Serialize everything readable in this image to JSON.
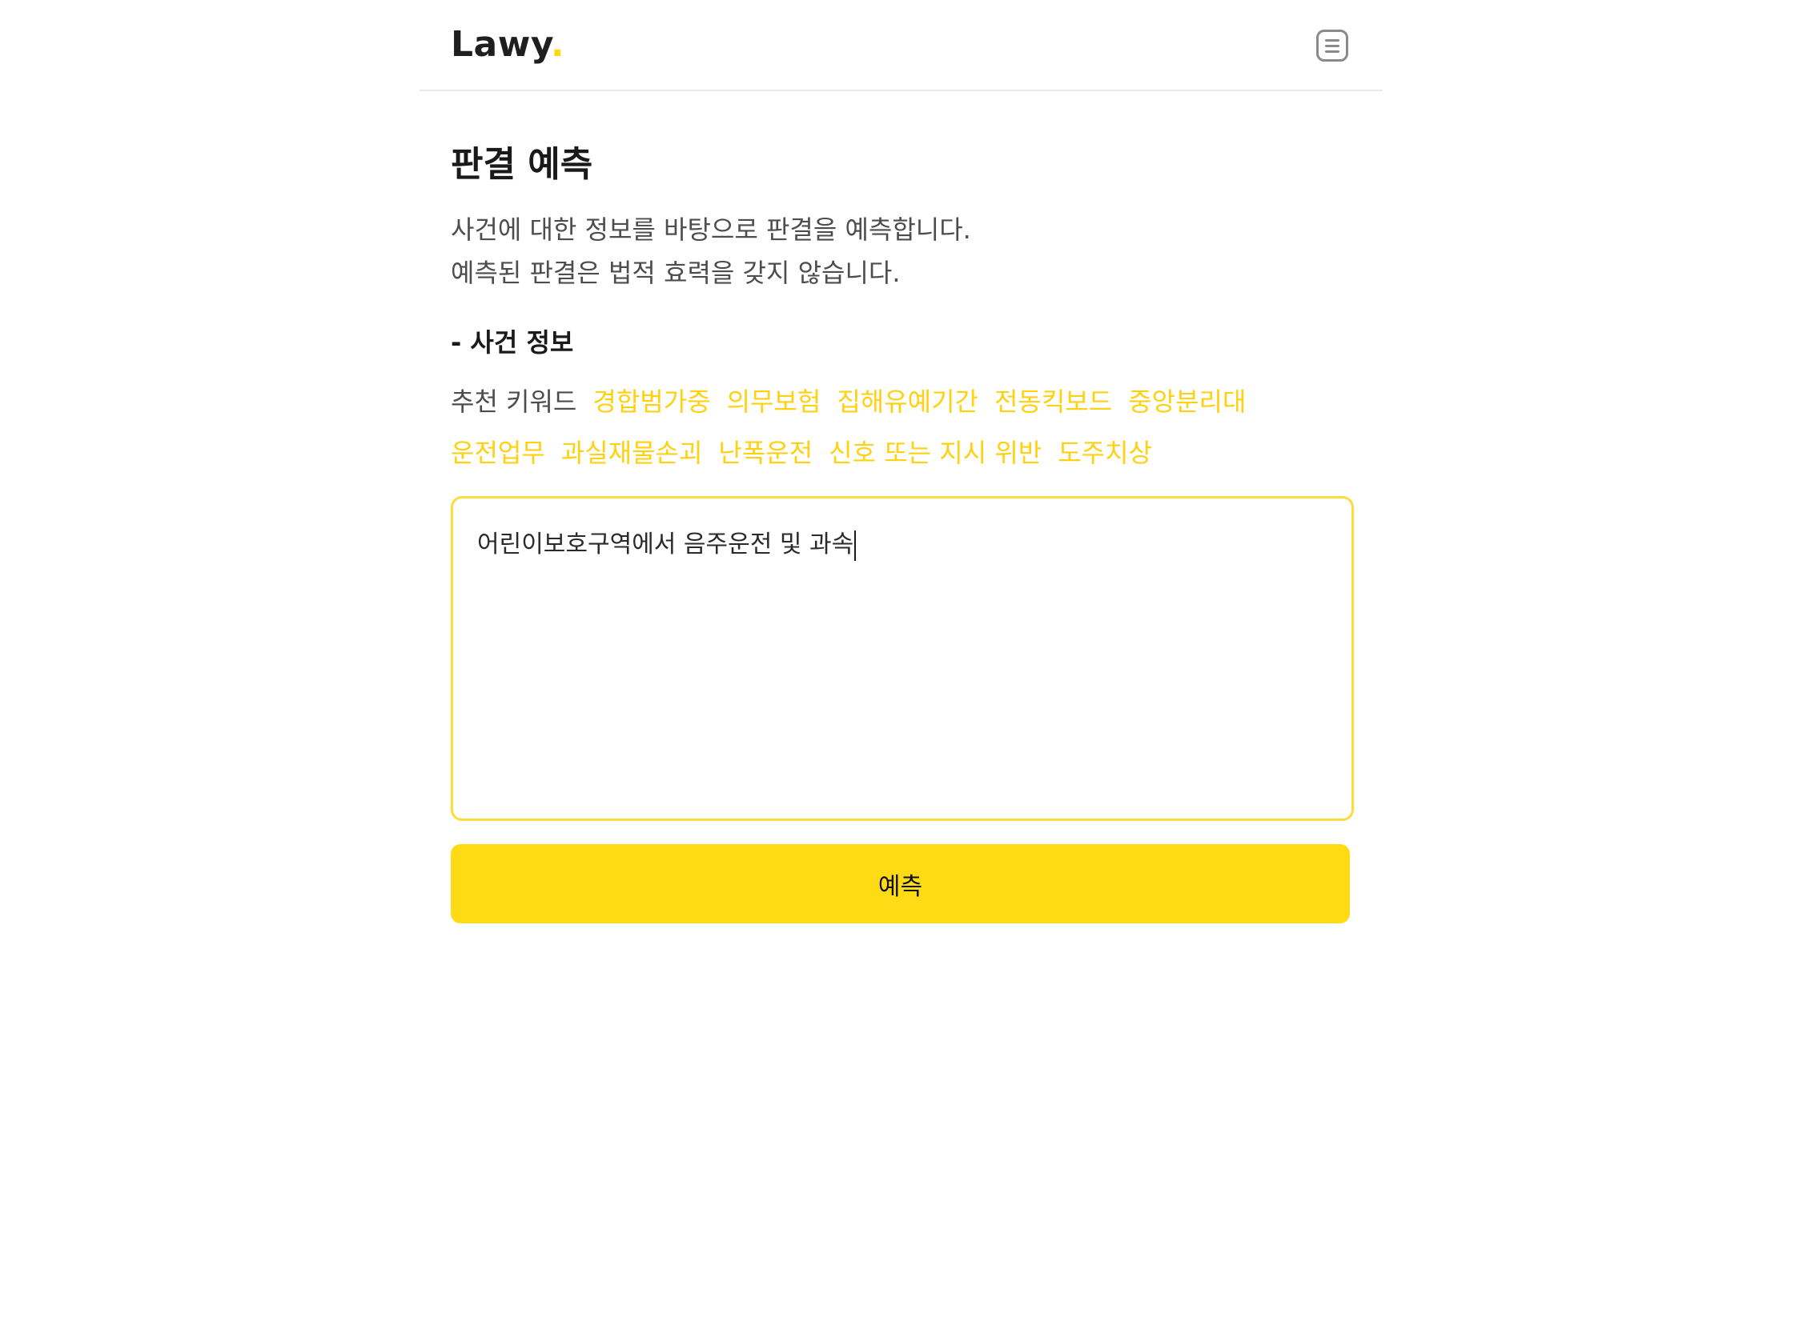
{
  "header": {
    "logo_text": "Lawy",
    "logo_dot": ".",
    "menu_icon": "hamburger-menu-icon"
  },
  "main": {
    "title": "판결 예측",
    "description_line1": "사건에 대한 정보를 바탕으로 판결을 예측합니다.",
    "description_line2": "예측된 판결은 법적 효력을 갖지 않습니다.",
    "section_title": "- 사건 정보",
    "keywords_label": "추천 키워드",
    "keywords": [
      "경합범가중",
      "의무보험",
      "집해유예기간",
      "전동킥보드",
      "중앙분리대",
      "운전업무",
      "과실재물손괴",
      "난폭운전",
      "신호 또는 지시 위반",
      "도주치상"
    ],
    "input_value": "어린이보호구역에서 음주운전 및 과속",
    "predict_button_label": "예측"
  },
  "colors": {
    "accent": "#ffdb15",
    "keyword": "#ffd110",
    "border": "#ffdb3c"
  }
}
